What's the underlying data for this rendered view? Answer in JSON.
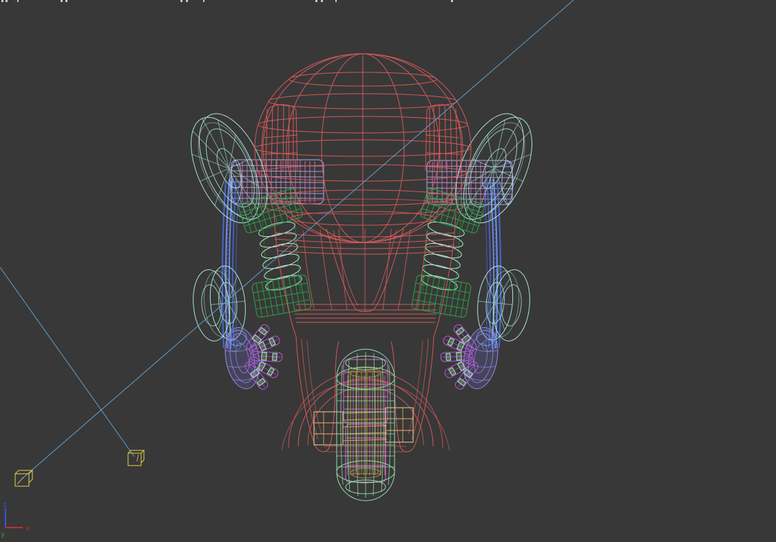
{
  "viewport": {
    "kind": "3d-wireframe-viewport",
    "description": "Front orthographic/perspective viewport of a wireframe scooter-robot model with suspension springs, side wheels, arms and a front wheel; two yellow helper boxes with light-target lines and a world axis tripod.",
    "background": "#383838"
  },
  "axis_gizmo": {
    "x_label": "x",
    "y_label": "y",
    "z_label": "z"
  },
  "colors": {
    "bg": "#383838",
    "red": "#df5a5a",
    "lavender": "#b3aaee",
    "pinkring": "#e37cc8",
    "green": "#2aa845",
    "green_dark": "#1d7a33",
    "mint": "#c6f2dc",
    "cyan_wheel": "#a9e8da",
    "blue_arm": "#6f8fee",
    "blue_arm_dark": "#4a66d2",
    "palm": "#978ce2",
    "palm_patch": "#6aa4ee",
    "finger": "#bd57e6",
    "finger_band": "#b2eec6",
    "wheel_mint": "#96dfae",
    "magenta": "#e066d8",
    "olive": "#b49a2e",
    "pink_inner": "#ef8fd8",
    "orange": "#e09a50",
    "orange_light": "#f0b060",
    "cream": "#f6cf8e",
    "yellow": "#e6d44e",
    "target_line": "#63a0cf",
    "axis_x": "#c03030",
    "axis_y": "#2f9e3f",
    "axis_z": "#3a55d8",
    "fragment": "#c8c8c8"
  },
  "scene": {
    "objects": [
      {
        "name": "head-sphere",
        "color": "#df5a5a"
      },
      {
        "name": "body-fairing",
        "color": "#df5a5a"
      },
      {
        "name": "left-steering-housing",
        "color": "#df5a5a"
      },
      {
        "name": "right-steering-housing",
        "color": "#df5a5a"
      },
      {
        "name": "left-axle-cylinder",
        "color": "#b3aaee"
      },
      {
        "name": "right-axle-cylinder",
        "color": "#b3aaee"
      },
      {
        "name": "left-shock-spring",
        "color": "#2aa845"
      },
      {
        "name": "right-shock-spring",
        "color": "#2aa845"
      },
      {
        "name": "left-upper-wheel",
        "color": "#a9e8da"
      },
      {
        "name": "right-upper-wheel",
        "color": "#a9e8da"
      },
      {
        "name": "left-lower-wheel",
        "color": "#a9e8da"
      },
      {
        "name": "right-lower-wheel",
        "color": "#a9e8da"
      },
      {
        "name": "left-arm-strut",
        "color": "#6f8fee"
      },
      {
        "name": "right-arm-strut",
        "color": "#6f8fee"
      },
      {
        "name": "left-hand",
        "color": "#bd57e6"
      },
      {
        "name": "right-hand",
        "color": "#bd57e6"
      },
      {
        "name": "front-wheel",
        "color": "#96dfae"
      },
      {
        "name": "front-hub-cylinder",
        "color": "#b49a2e"
      },
      {
        "name": "axle-block",
        "color": "#e09a50"
      },
      {
        "name": "helper-box-1",
        "color": "#e6d44e"
      },
      {
        "name": "helper-box-2",
        "color": "#e6d44e"
      },
      {
        "name": "target-line-1",
        "color": "#63a0cf"
      },
      {
        "name": "target-line-2",
        "color": "#63a0cf"
      }
    ]
  }
}
